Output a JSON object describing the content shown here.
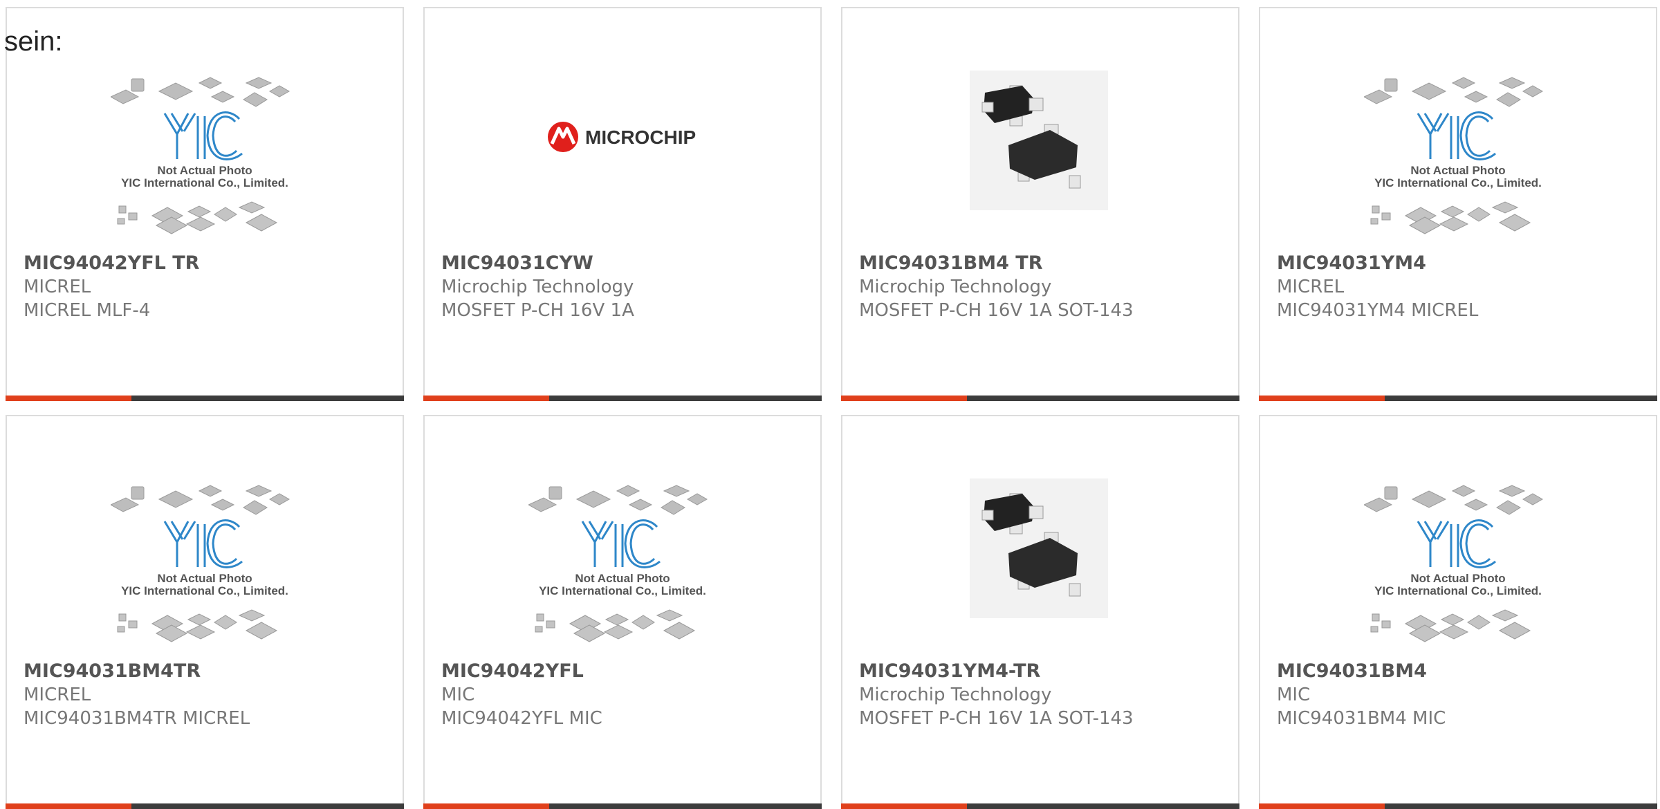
{
  "lead_text": "sein:",
  "colors": {
    "accent": "#e0401c",
    "bar": "#3c3c3c",
    "text": "#555555"
  },
  "products": [
    {
      "part": "MIC94042YFL TR",
      "maker": "MICREL",
      "desc": "MICREL MLF-4",
      "image": "yic-placeholder",
      "placeholder_line1": "Not Actual Photo",
      "placeholder_line2": "YIC International Co., Limited."
    },
    {
      "part": "MIC94031CYW",
      "maker": "Microchip Technology",
      "desc": "MOSFET P-CH 16V 1A",
      "image": "microchip-logo",
      "logo_text": "MICROCHIP"
    },
    {
      "part": "MIC94031BM4 TR",
      "maker": "Microchip Technology",
      "desc": "MOSFET P-CH 16V 1A SOT-143",
      "image": "sot143-package"
    },
    {
      "part": "MIC94031YM4",
      "maker": "MICREL",
      "desc": "MIC94031YM4 MICREL",
      "image": "yic-placeholder",
      "placeholder_line1": "Not Actual Photo",
      "placeholder_line2": "YIC International Co., Limited."
    },
    {
      "part": "MIC94031BM4TR",
      "maker": "MICREL",
      "desc": "MIC94031BM4TR MICREL",
      "image": "yic-placeholder",
      "placeholder_line1": "Not Actual Photo",
      "placeholder_line2": "YIC International Co., Limited."
    },
    {
      "part": "MIC94042YFL",
      "maker": "MIC",
      "desc": "MIC94042YFL MIC",
      "image": "yic-placeholder",
      "placeholder_line1": "Not Actual Photo",
      "placeholder_line2": "YIC International Co., Limited."
    },
    {
      "part": "MIC94031YM4-TR",
      "maker": "Microchip Technology",
      "desc": "MOSFET P-CH 16V 1A SOT-143",
      "image": "sot143-package"
    },
    {
      "part": "MIC94031BM4",
      "maker": "MIC",
      "desc": "MIC94031BM4 MIC",
      "image": "yic-placeholder",
      "placeholder_line1": "Not Actual Photo",
      "placeholder_line2": "YIC International Co., Limited."
    }
  ]
}
